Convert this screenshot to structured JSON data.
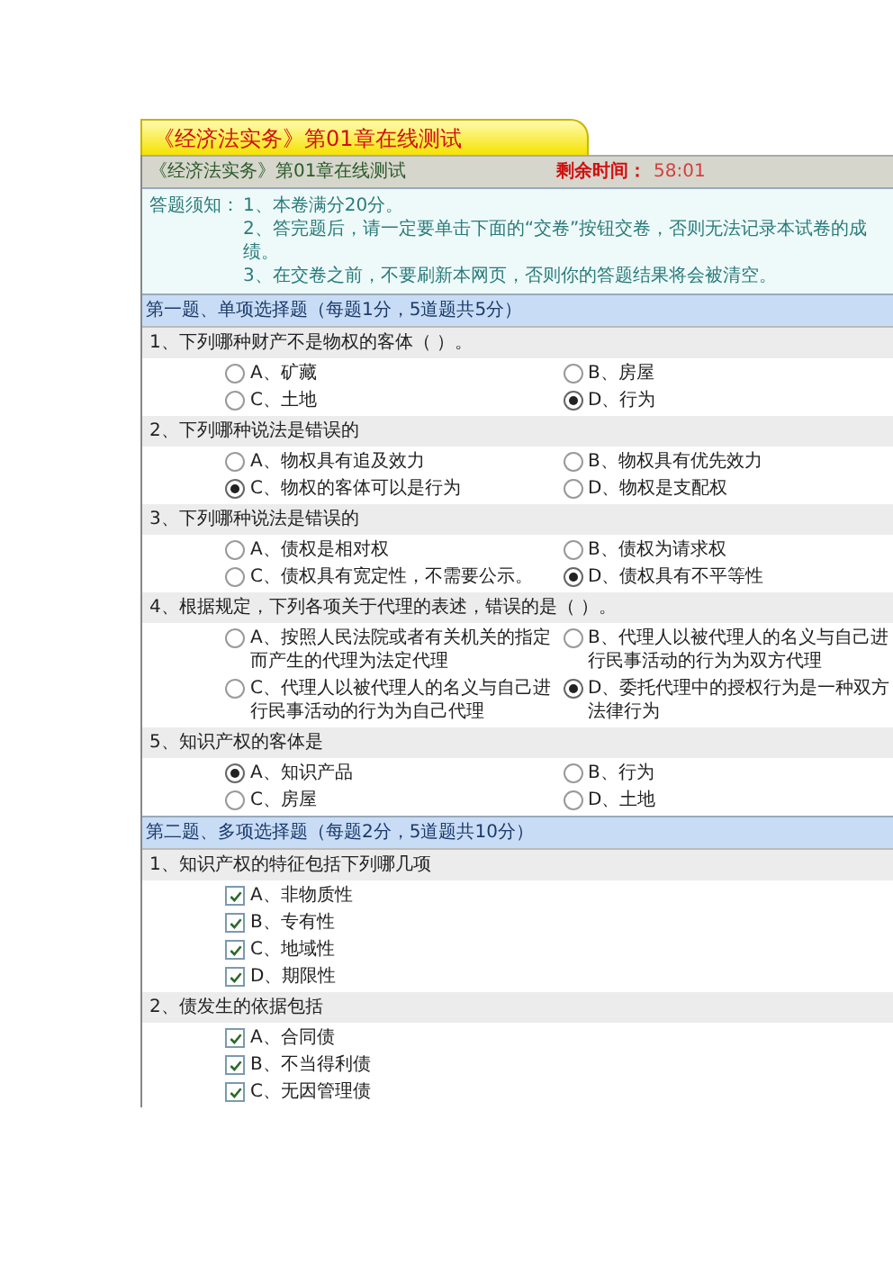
{
  "tab_title": "《经济法实务》第01章在线测试",
  "header": {
    "title": "《经济法实务》第01章在线测试",
    "timer_label": "剩余时间：",
    "timer_value": "58:01"
  },
  "notice": {
    "label": "答题须知：",
    "items": [
      "1、本卷满分20分。",
      "2、答完题后，请一定要单击下面的“交卷”按钮交卷，否则无法记录本试卷的成绩。",
      "3、在交卷之前，不要刷新本网页，否则你的答题结果将会被清空。"
    ]
  },
  "sections": [
    {
      "title": "第一题、单项选择题（每题1分，5道题共5分）",
      "kind": "single",
      "questions": [
        {
          "text": "1、下列哪种财产不是物权的客体（ ）。",
          "options": [
            {
              "label": "A、矿藏",
              "selected": false
            },
            {
              "label": "B、房屋",
              "selected": false
            },
            {
              "label": "C、土地",
              "selected": false
            },
            {
              "label": "D、行为",
              "selected": true
            }
          ]
        },
        {
          "text": "2、下列哪种说法是错误的",
          "options": [
            {
              "label": "A、物权具有追及效力",
              "selected": false
            },
            {
              "label": "B、物权具有优先效力",
              "selected": false
            },
            {
              "label": "C、物权的客体可以是行为",
              "selected": true
            },
            {
              "label": "D、物权是支配权",
              "selected": false
            }
          ]
        },
        {
          "text": "3、下列哪种说法是错误的",
          "options": [
            {
              "label": "A、债权是相对权",
              "selected": false
            },
            {
              "label": "B、债权为请求权",
              "selected": false
            },
            {
              "label": "C、债权具有宽定性，不需要公示。",
              "selected": false
            },
            {
              "label": "D、债权具有不平等性",
              "selected": true
            }
          ]
        },
        {
          "text": "4、根据规定，下列各项关于代理的表述，错误的是（ ）。",
          "options": [
            {
              "label": "A、按照人民法院或者有关机关的指定而产生的代理为法定代理",
              "selected": false
            },
            {
              "label": "B、代理人以被代理人的名义与自己进行民事活动的行为为双方代理",
              "selected": false
            },
            {
              "label": "C、代理人以被代理人的名义与自己进行民事活动的行为为自己代理",
              "selected": false
            },
            {
              "label": "D、委托代理中的授权行为是一种双方法律行为",
              "selected": true
            }
          ]
        },
        {
          "text": "5、知识产权的客体是",
          "options": [
            {
              "label": "A、知识产品",
              "selected": true
            },
            {
              "label": "B、行为",
              "selected": false
            },
            {
              "label": "C、房屋",
              "selected": false
            },
            {
              "label": "D、土地",
              "selected": false
            }
          ]
        }
      ]
    },
    {
      "title": "第二题、多项选择题（每题2分，5道题共10分）",
      "kind": "multiple",
      "questions": [
        {
          "text": "1、知识产权的特征包括下列哪几项",
          "options": [
            {
              "label": "A、非物质性",
              "checked": true
            },
            {
              "label": "B、专有性",
              "checked": true
            },
            {
              "label": "C、地域性",
              "checked": true
            },
            {
              "label": "D、期限性",
              "checked": true
            }
          ]
        },
        {
          "text": "2、债发生的依据包括",
          "options": [
            {
              "label": "A、合同债",
              "checked": true
            },
            {
              "label": "B、不当得利债",
              "checked": true
            },
            {
              "label": "C、无因管理债",
              "checked": true
            }
          ]
        }
      ]
    }
  ]
}
